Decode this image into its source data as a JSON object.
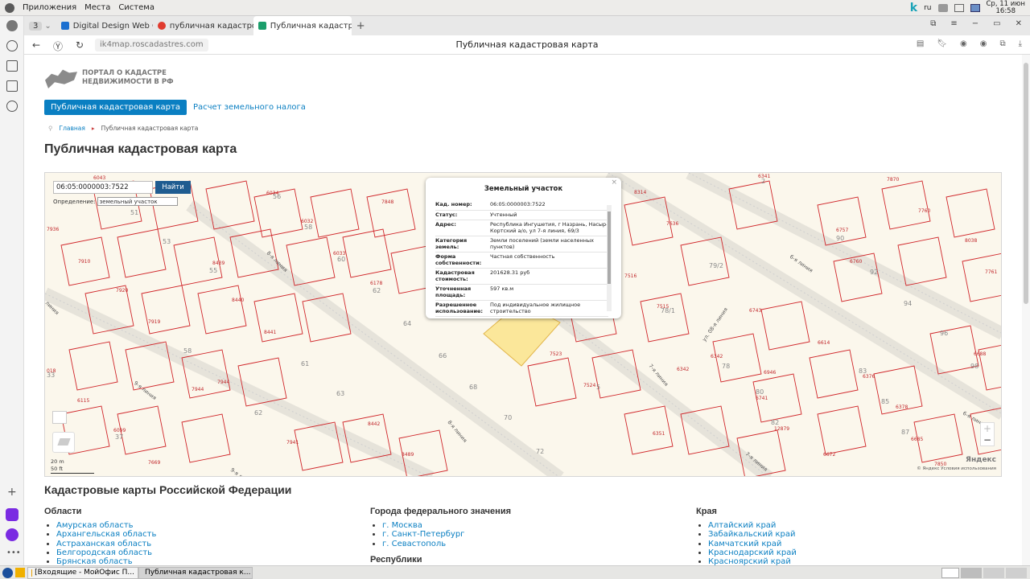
{
  "system_panel": {
    "menus": [
      "Приложения",
      "Места",
      "Система"
    ],
    "lang": "ru",
    "clock_line1": "Ср, 11 июн",
    "clock_line2": "16:58"
  },
  "browser": {
    "tab_count": "3",
    "tabs": [
      {
        "label": "Digital Design Web Clie",
        "color": "#1b6fd0"
      },
      {
        "label": "публичная кадастрова",
        "color": "#e03b2f"
      },
      {
        "label": "Публичная кадастрова",
        "color": "#1b9e6b"
      }
    ],
    "url": "ik4map.roscadastres.com",
    "page_title": "Публичная кадастровая карта"
  },
  "site": {
    "logo_line1": "ПОРТАЛ О КАДАСТРЕ",
    "logo_line2": "НЕДВИЖИМОСТИ В РФ",
    "nav": [
      "Публичная кадастровая карта",
      "Расчет земельного налога"
    ],
    "breadcrumb": [
      "Главная",
      "Публичная кадастровая карта"
    ],
    "heading": "Публичная кадастровая карта"
  },
  "map": {
    "search_value": "06:05:0000003:7522",
    "search_button": "Найти",
    "definition_label": "Определение:",
    "definition_value": "земельный участок",
    "popup": {
      "title": "Земельный участок",
      "close": "×",
      "rows": [
        {
          "k": "Кад. номер:",
          "v": "06:05:0000003:7522"
        },
        {
          "k": "Статус:",
          "v": "Учтенный"
        },
        {
          "k": "Адрес:",
          "v": "Республика Ингушетия, г Назрань, Насыр-Кортский а/о, ул 7-я линия, 69/3"
        },
        {
          "k": "Категория земель:",
          "v": "Земли поселений (земли населенных пунктов)"
        },
        {
          "k": "Форма собственности:",
          "v": "Частная собственность"
        },
        {
          "k": "Кадастровая стоимость:",
          "v": "201628.31 руб"
        },
        {
          "k": "Уточненная площадь:",
          "v": "597 кв.м"
        },
        {
          "k": "Разрешенное использование:",
          "v": "Под индивидуальное жилищное строительство"
        }
      ]
    },
    "scale_m": "20 m",
    "scale_ft": "50 ft",
    "zoom_in": "+",
    "zoom_out": "−",
    "provider": "Яндекс",
    "copyright": "© Яндекс Условия использования",
    "parcel_labels": [
      {
        "t": "6043",
        "c": "p"
      },
      {
        "t": "6034",
        "c": "p"
      },
      {
        "t": "56",
        "c": "b"
      },
      {
        "t": "7848",
        "c": "p"
      },
      {
        "t": "7936",
        "c": "p"
      },
      {
        "t": "51",
        "c": "b"
      },
      {
        "t": "53",
        "c": "b"
      },
      {
        "t": "6032",
        "c": "p"
      },
      {
        "t": "58",
        "c": "b"
      },
      {
        "t": "6033",
        "c": "p"
      },
      {
        "t": "60",
        "c": "b"
      },
      {
        "t": "7910",
        "c": "p"
      },
      {
        "t": "8439",
        "c": "p"
      },
      {
        "t": "55",
        "c": "b"
      },
      {
        "t": "6178",
        "c": "p"
      },
      {
        "t": "62",
        "c": "b"
      },
      {
        "t": "7920",
        "c": "p"
      },
      {
        "t": "8440",
        "c": "p"
      },
      {
        "t": "7919",
        "c": "p"
      },
      {
        "t": "8441",
        "c": "p"
      },
      {
        "t": "64",
        "c": "b"
      },
      {
        "t": "58",
        "c": "b"
      },
      {
        "t": "66",
        "c": "b"
      },
      {
        "t": "61",
        "c": "b"
      },
      {
        "t": "018",
        "c": "p"
      },
      {
        "t": "33",
        "c": "b"
      },
      {
        "t": "7944",
        "c": "p"
      },
      {
        "t": "7944",
        "c": "p"
      },
      {
        "t": "63",
        "c": "b"
      },
      {
        "t": "6115",
        "c": "p"
      },
      {
        "t": "62",
        "c": "b"
      },
      {
        "t": "8442",
        "c": "p"
      },
      {
        "t": "68",
        "c": "b"
      },
      {
        "t": "6099",
        "c": "p"
      },
      {
        "t": "37",
        "c": "b"
      },
      {
        "t": "7941",
        "c": "p"
      },
      {
        "t": "70",
        "c": "b"
      },
      {
        "t": "8489",
        "c": "p"
      },
      {
        "t": "7669",
        "c": "p"
      },
      {
        "t": "72",
        "c": "b"
      },
      {
        "t": "6341",
        "c": "p"
      },
      {
        "t": "2",
        "c": "b"
      },
      {
        "t": "7870",
        "c": "p"
      },
      {
        "t": "8314",
        "c": "p"
      },
      {
        "t": "7636",
        "c": "p"
      },
      {
        "t": "7760",
        "c": "p"
      },
      {
        "t": "6757",
        "c": "p"
      },
      {
        "t": "90",
        "c": "b"
      },
      {
        "t": "8038",
        "c": "p"
      },
      {
        "t": "6760",
        "c": "p"
      },
      {
        "t": "92",
        "c": "b"
      },
      {
        "t": "79/2",
        "c": "b"
      },
      {
        "t": "7761",
        "c": "p"
      },
      {
        "t": "7516",
        "c": "p"
      },
      {
        "t": "7515",
        "c": "p"
      },
      {
        "t": "78/1",
        "c": "b"
      },
      {
        "t": "94",
        "c": "b"
      },
      {
        "t": "6743",
        "c": "p"
      },
      {
        "t": "96",
        "c": "b"
      },
      {
        "t": "7523",
        "c": "p"
      },
      {
        "t": "7524",
        "c": "p"
      },
      {
        "t": "5",
        "c": "b"
      },
      {
        "t": "6342",
        "c": "p"
      },
      {
        "t": "6614",
        "c": "p"
      },
      {
        "t": "6342",
        "c": "p"
      },
      {
        "t": "78",
        "c": "b"
      },
      {
        "t": "6688",
        "c": "p"
      },
      {
        "t": "98",
        "c": "b"
      },
      {
        "t": "6946",
        "c": "p"
      },
      {
        "t": "83",
        "c": "b"
      },
      {
        "t": "6376",
        "c": "p"
      },
      {
        "t": "80",
        "c": "b"
      },
      {
        "t": "6741",
        "c": "p"
      },
      {
        "t": "85",
        "c": "b"
      },
      {
        "t": "6378",
        "c": "p"
      },
      {
        "t": "82",
        "c": "b"
      },
      {
        "t": "12879",
        "c": "p"
      },
      {
        "t": "6351",
        "c": "p"
      },
      {
        "t": "6672",
        "c": "p"
      },
      {
        "t": "87",
        "c": "b"
      },
      {
        "t": "6685",
        "c": "p"
      },
      {
        "t": "7850",
        "c": "p"
      }
    ],
    "street_labels": [
      "8-я линия",
      "9-я линия",
      "9-я линия",
      "8-я линия",
      "7-я линия",
      "7-я линия",
      "6-я линия",
      "6-я линия",
      "ул. 08-я линия",
      "линия"
    ]
  },
  "regions": {
    "heading": "Кадастровые карты Российской Федерации",
    "columns": [
      {
        "title": "Области",
        "items": [
          "Амурская область",
          "Архангельская область",
          "Астраханская область",
          "Белгородская область",
          "Брянская область"
        ]
      },
      {
        "title": "Города федерального значения",
        "items": [
          "г. Москва",
          "г. Санкт-Петербург",
          "г. Севастополь"
        ],
        "subtitle": "Республики"
      },
      {
        "title": "Края",
        "items": [
          "Алтайский край",
          "Забайкальский край",
          "Камчатский край",
          "Краснодарский край",
          "Красноярский край"
        ]
      }
    ]
  },
  "taskbar": {
    "items": [
      "[Входящие - МойОфис П...",
      "Публичная кадастровая к..."
    ]
  },
  "colors": {
    "accent": "#0a7fc2",
    "parcel_line": "#d0262a",
    "selected_parcel": "#fbe79a"
  }
}
